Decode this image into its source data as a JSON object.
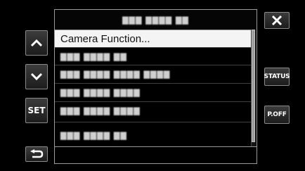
{
  "left_controls": {
    "up_icon": "chevron-up",
    "down_icon": "chevron-down",
    "set_label": "SET",
    "back_icon": "return-arrow"
  },
  "right_controls": {
    "close_icon": "close-x",
    "status_label": "STATUS",
    "poff_label": "P.OFF"
  },
  "menu": {
    "title": "▇▇▇ ▇▇▇▇ ▇▇",
    "items": [
      {
        "label": "Camera Function..."
      },
      {
        "label": "▇▇▇ ▇▇▇▇ ▇▇"
      },
      {
        "label": "▇▇▇ ▇▇▇▇ ▇▇▇▇ ▇▇▇▇"
      },
      {
        "label": "▇▇▇ ▇▇▇▇ ▇▇▇▇"
      },
      {
        "label": "▇▇▇ ▇▇▇▇ ▇▇▇▇"
      },
      {
        "label": "▇▇▇ ▇▇▇▇ ▇▇"
      }
    ],
    "selected_index": 0
  },
  "colors": {
    "background": "#000000",
    "selected_row": "#f4f4f4",
    "border": "#9a9a9a"
  }
}
